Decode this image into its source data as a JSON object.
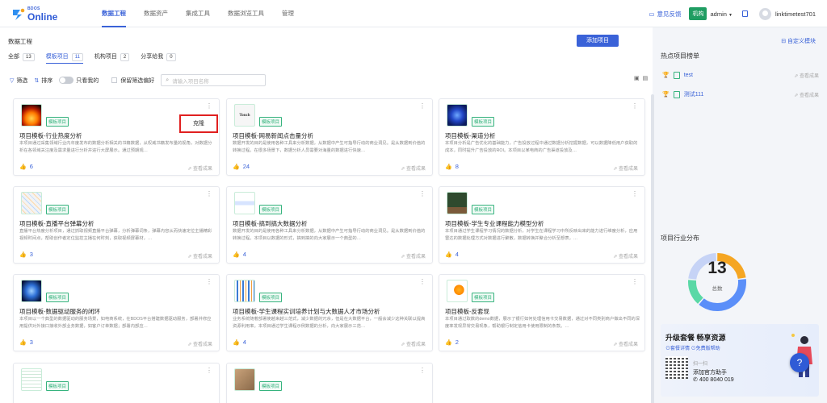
{
  "logo": {
    "small": "BDOS",
    "big": "Online"
  },
  "nav": [
    {
      "label": "数据工程",
      "active": true
    },
    {
      "label": "数据资产",
      "active": false
    },
    {
      "label": "集成工具",
      "active": false
    },
    {
      "label": "数据浏览工具",
      "active": false
    },
    {
      "label": "管理",
      "active": false
    }
  ],
  "topright": {
    "feedback": "意见反馈",
    "org": "机构",
    "admin": "admin",
    "user": "linktimetest701"
  },
  "page": {
    "title": "数据工程",
    "add_button": "添加项目"
  },
  "tabs": [
    {
      "label": "全部",
      "count": "13"
    },
    {
      "label": "模板项目",
      "count": "11"
    },
    {
      "label": "机构项目",
      "count": "2"
    },
    {
      "label": "分享给我",
      "count": "0"
    }
  ],
  "filters": {
    "filter": "筛选",
    "sort": "排序",
    "only_mine": "只看我的",
    "keep": "保留筛选偏好",
    "search_placeholder": "请输入项目名称"
  },
  "cards": [
    {
      "title": "项目模板-行业热度分析",
      "tag": "模板项目",
      "desc": "本项目通过采集领域行业内年度发布的数据分析相关的书籍数据，从权威书籍发布量的视角，对数据分析在各领域关注度及需求量进行分析并进行大屏展示。通过预期观…",
      "likes": "6",
      "view": "查看成果",
      "thumb": "fire"
    },
    {
      "title": "项目模板-网易新闻点击量分析",
      "tag": "模板项目",
      "desc": "数据开发的目的是使用各种工具来分析数据，从数据中产生可指导行动的商业洞见。是从数据到价值的转换过程。在很多场景下，数据分析人员需要对海量的数据进行快速…",
      "likes": "24",
      "view": "查看成果",
      "thumb": "touch",
      "thumb_text": "Touch"
    },
    {
      "title": "项目模板-渠道分析",
      "tag": "模板项目",
      "desc": "本项目分析是广告优化的基础能力，广告投放过程中通过数据分析挖掘数据，可以数据降低用户获取的成本，同时提升广告投放的ROI。本项目以某电商的广告渠道投放及…",
      "likes": "8",
      "view": "查看成果",
      "thumb": "channel"
    },
    {
      "title": "项目模板-直播平台弹幕分析",
      "tag": "模板项目",
      "desc": "直播平台热度分析项目，通过抓取视频直播平台弹幕，分析弹幕词条，弹幕内容从而快速定位主播精彩视频时间点，帮助创作者定位监控主播在何时刻，获取视频屏幕材，…",
      "likes": "3",
      "view": "查看成果",
      "thumb": "live"
    },
    {
      "title": "项目模板-搞到搞大数据分析",
      "tag": "模板项目",
      "desc": "数据开发的目的是使用各种工具来分析数据，从数据中产生可指导行动的商业洞见。是从数据到价值的转换过程。本项目以数据的形式，搞到搞的向大家展示一个典型的…",
      "likes": "4",
      "view": "查看成果",
      "thumb": "chart"
    },
    {
      "title": "项目模板-学生专业课程能力模型分析",
      "tag": "模板项目",
      "desc": "本项目通过学生课程学习情况的数据分析，对学生在课程学习中所反映出来的能力进行维度分析，应用雷达的数据处理方式对数据进行聚散，数据转换并聚合分析至想表，…",
      "likes": "4",
      "view": "查看成果",
      "thumb": "class"
    },
    {
      "title": "项目模板-数据驱动服务的闭环",
      "tag": "模板项目",
      "desc": "本项目以一个典型的数据驱动的服务场景，如电商系统，在BDOS平台搭建数据驱动服务，部署并修应用提供对外接口接收外部业务数据，如客户订单数据；部署内部应…",
      "likes": "3",
      "view": "查看成果",
      "thumb": "xray"
    },
    {
      "title": "项目模板-学生课程实训培养计划与大数据人才市场分析",
      "tag": "模板项目",
      "desc": "业务系统随着部署使越来越三范式，减少数据的冗余，但是在大数据平台，一般会减少这种关联以提高资源利用率。本项目通过学生课程示例数据的分析，向大家展示三范…",
      "likes": "4",
      "view": "查看成果",
      "thumb": "people"
    },
    {
      "title": "项目模板-反套现",
      "tag": "模板项目",
      "desc": "本项目通过取数的demo数据，展示了银行如何处理信用卡交易数据，通过对不同类别商户做出不同的深度率发现异常交易现象，帮助银行制定信用卡使用限制的条款。…",
      "likes": "2",
      "view": "查看成果",
      "thumb": "coin"
    },
    {
      "title": "",
      "tag": "模板项目",
      "desc": "",
      "likes": "",
      "view": "",
      "thumb": "sheet"
    },
    {
      "title": "",
      "tag": "模板项目",
      "desc": "",
      "likes": "",
      "view": "",
      "thumb": "hands"
    }
  ],
  "clone_popup": "克隆",
  "sidebar": {
    "custom": "自定义模块",
    "hot_title": "热点项目榜单",
    "hot_items": [
      {
        "name": "test",
        "view": "查看成果"
      },
      {
        "name": "测试111",
        "view": "查看成果"
      }
    ],
    "dist_title": "项目行业分布",
    "donut_total": "13",
    "donut_label": "总数",
    "donut_segments": [
      {
        "color": "#f5a623",
        "value": 3
      },
      {
        "color": "#5b8ff9",
        "value": 5
      },
      {
        "color": "#5ad8a6",
        "value": 2
      },
      {
        "color": "#c6d3f6",
        "value": 3
      }
    ],
    "promo": {
      "title": "升级套餐 畅享资源",
      "links": "⊙套餐详情 ⊙免费版帮助",
      "scan": "扫一扫",
      "assistant": "添加官方助手",
      "phone": "400 8040 019"
    }
  },
  "colors": {
    "accent": "#3a62d8",
    "green": "#36b37e"
  }
}
